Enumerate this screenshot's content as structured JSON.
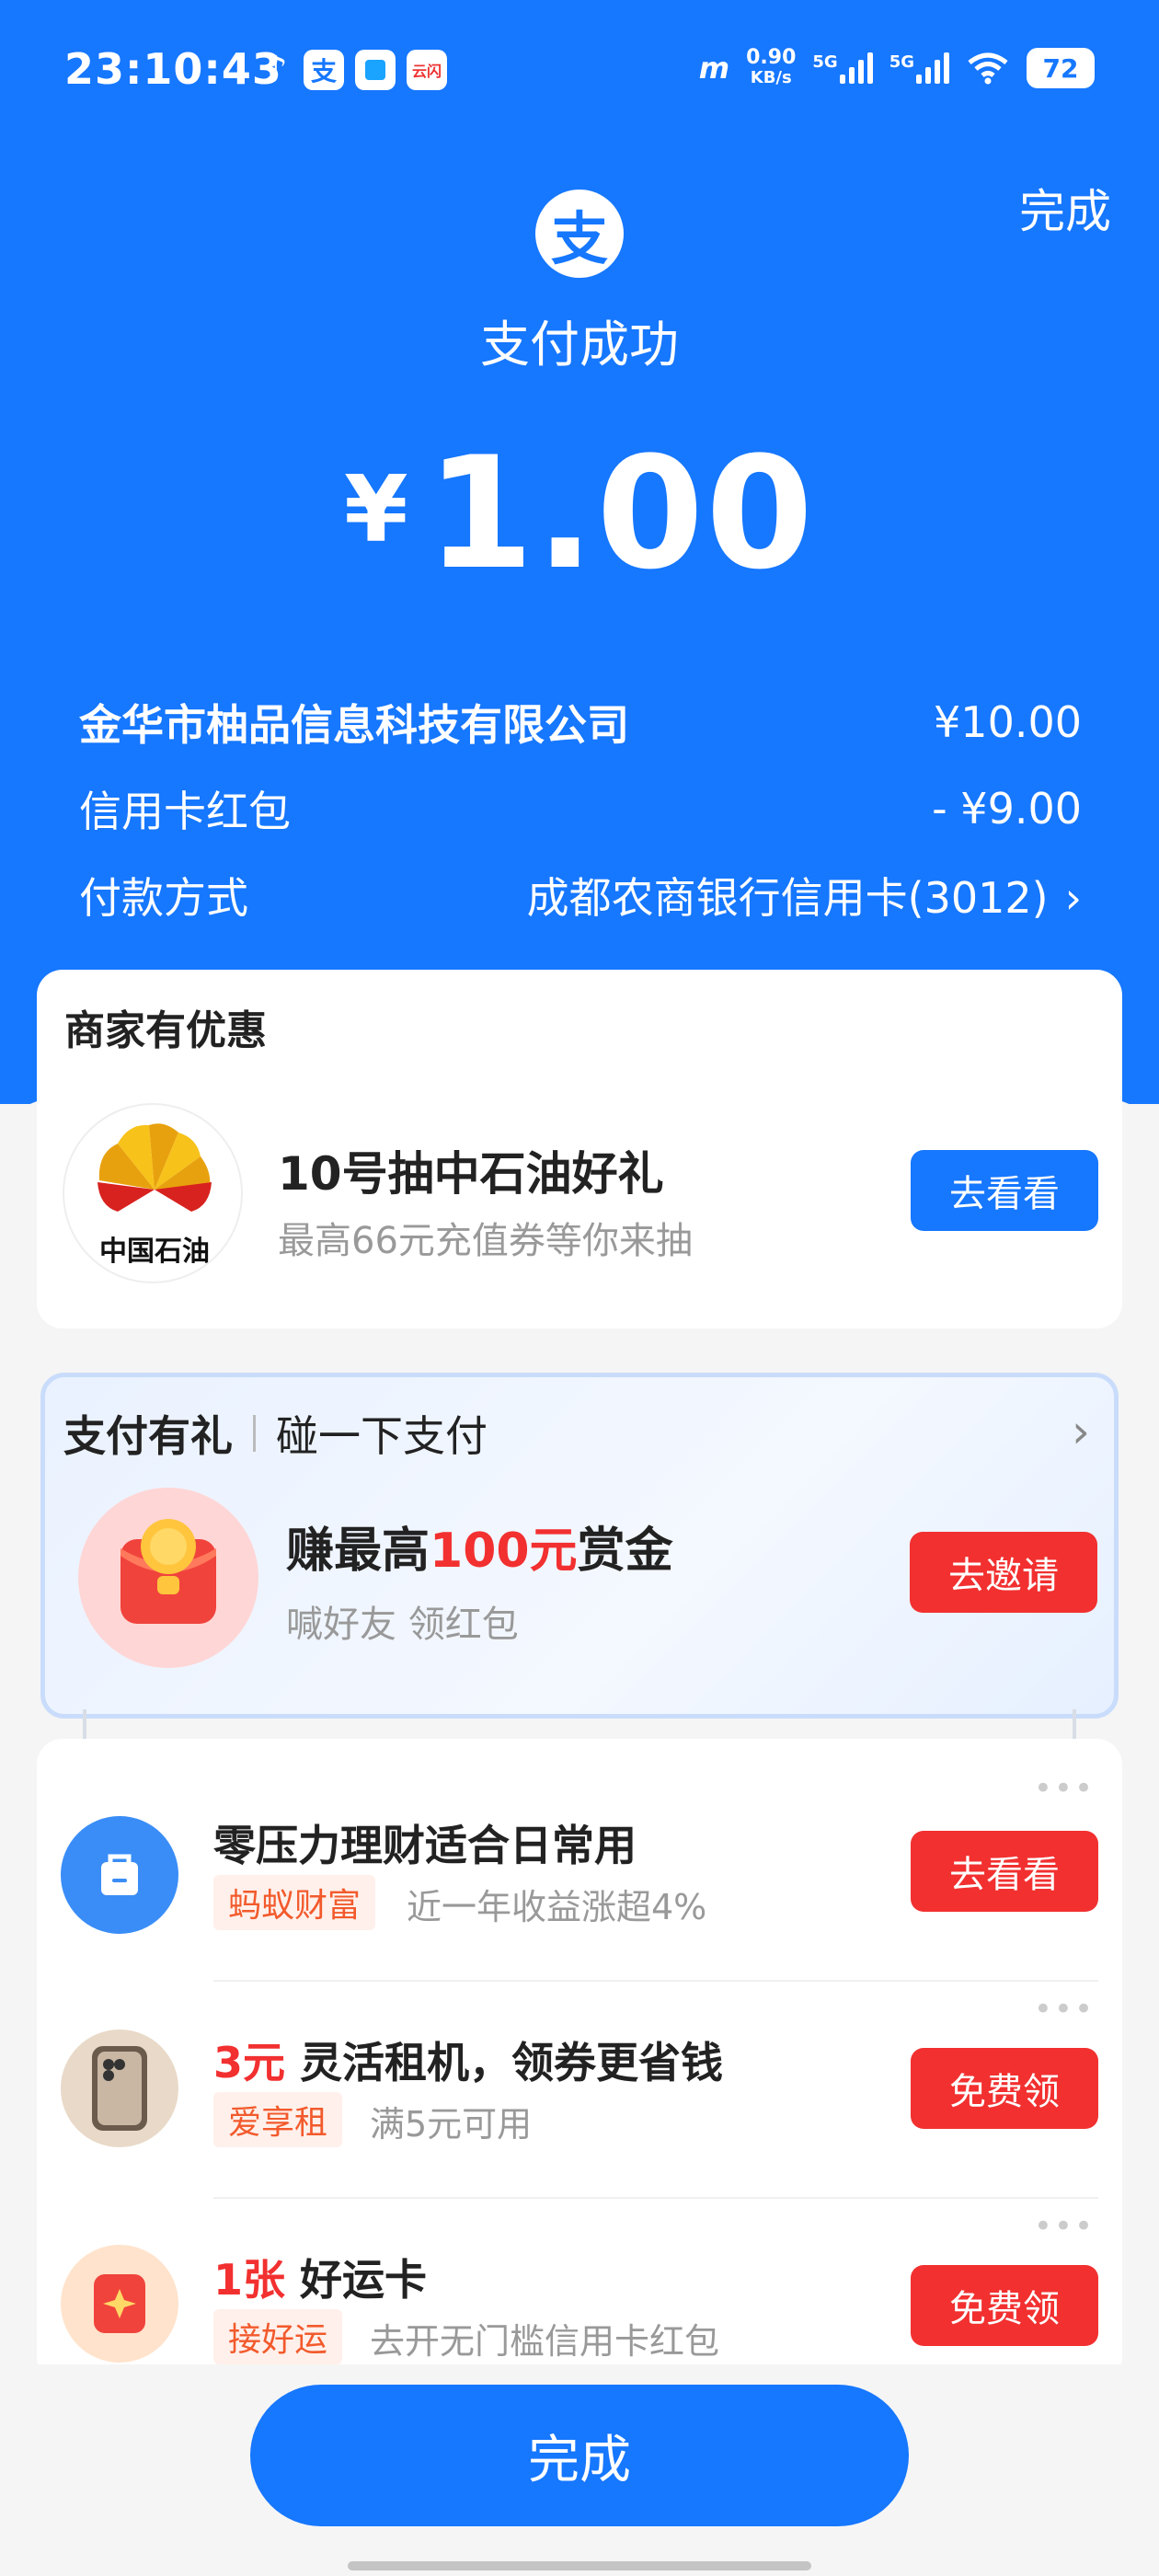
{
  "status_bar": {
    "time": "23:10:43",
    "net_speed_value": "0.90",
    "net_speed_unit": "KB/s",
    "signal1": "5G",
    "signal2": "5G",
    "battery": "72"
  },
  "header": {
    "done_label": "完成",
    "title": "支付成功",
    "currency": "¥",
    "amount": "1.00"
  },
  "summary": {
    "merchant": "金华市柚品信息科技有限公司",
    "merchant_amount": "¥10.00",
    "discount_label": "信用卡红包",
    "discount_amount": "- ¥9.00",
    "method_label": "付款方式",
    "method_value": "成都农商银行信用卡(3012)"
  },
  "merchant_offer": {
    "section_title": "商家有优惠",
    "brand": "中国石油",
    "title": "10号抽中石油好礼",
    "subtitle": "最高66元充值券等你来抽",
    "button": "去看看"
  },
  "pay_gift": {
    "title": "支付有礼",
    "subtitle": "碰一下支付",
    "headline_prefix": "赚最高",
    "headline_highlight": "100元",
    "headline_suffix": "赏金",
    "description": "喊好友 领红包",
    "button": "去邀请"
  },
  "promos": [
    {
      "highlight": "",
      "title": "零压力理财适合日常用",
      "tag": "蚂蚁财富",
      "desc": "近一年收益涨超4%",
      "button": "去看看"
    },
    {
      "highlight": "3元",
      "title": " 灵活租机，领券更省钱",
      "tag": "爱享租",
      "desc": "满5元可用",
      "button": "免费领"
    },
    {
      "highlight": "1张",
      "title": " 好运卡",
      "tag": "接好运",
      "desc": "去开无门槛信用卡红包",
      "button": "免费领"
    }
  ],
  "bottom": {
    "done_label": "完成"
  },
  "colors": {
    "primary": "#1677ff",
    "danger": "#f23030",
    "tag": "#f25a2c"
  },
  "icons": [
    "alipay-logo-icon",
    "chevron-right-icon",
    "petrochina-logo",
    "red-packet-icon",
    "wallet-bag-icon",
    "phone-icon",
    "lucky-card-icon",
    "more-dots-icon"
  ]
}
